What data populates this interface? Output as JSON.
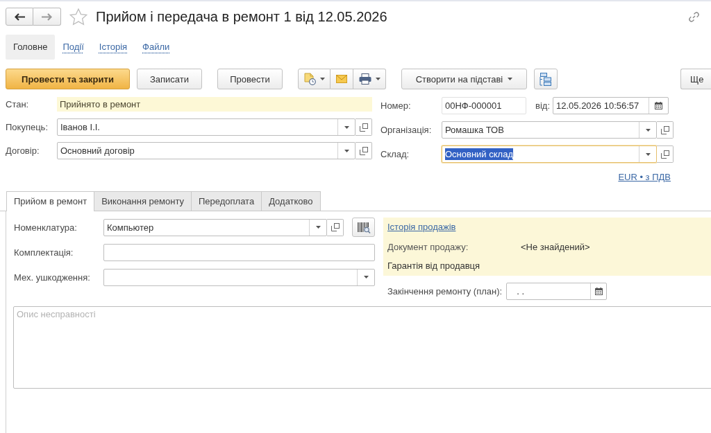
{
  "window": {
    "title": "Прийом і передача в ремонт 1 від 12.05.2026"
  },
  "sections": [
    {
      "label": "Головне",
      "selected": true
    },
    {
      "label": "Події",
      "selected": false
    },
    {
      "label": "Історія",
      "selected": false
    },
    {
      "label": "Файли",
      "selected": false
    }
  ],
  "toolbar": {
    "buttons": [
      {
        "label": "Провести та закрити",
        "kind": "primary"
      },
      {
        "label": "Записати",
        "kind": "plain"
      },
      {
        "label": "Провести",
        "kind": "plain"
      }
    ],
    "create_based_on": "Створити на підставі",
    "more": "Ще"
  },
  "header": {
    "status": {
      "label": "Стан:",
      "value": "Прийнято в ремонт"
    },
    "left_fields": [
      {
        "label": "Покупець:",
        "value": "Іванов І.І.",
        "focused": false
      },
      {
        "label": "Договір:",
        "value": "Основний договір",
        "focused": false
      }
    ],
    "number": {
      "label": "Номер:",
      "value": "00НФ-000001"
    },
    "date": {
      "label": "від:",
      "value": "12.05.2026 10:56:57"
    },
    "right_fields": [
      {
        "label": "Організація:",
        "value": "Ромашка ТОВ",
        "focused": false
      },
      {
        "label": "Склад:",
        "value": "Основний склад",
        "focused": true
      }
    ],
    "currency_link": "EUR • з ПДВ"
  },
  "tabs": [
    {
      "label": "Прийом в ремонт",
      "selected": true
    },
    {
      "label": "Виконання ремонту",
      "selected": false
    },
    {
      "label": "Передоплата",
      "selected": false
    },
    {
      "label": "Додатково",
      "selected": false
    }
  ],
  "repair_intake": {
    "fields": [
      {
        "kind": "catalog",
        "label": "Номенклатура:",
        "value": "Компьютер"
      },
      {
        "kind": "text",
        "label": "Комплектація:"
      },
      {
        "kind": "dropdown",
        "label": "Мех. ушкодження:"
      }
    ],
    "sales_info": {
      "link": "Історія продажів",
      "document_label": "Документ продажу:",
      "document_value": "<Не знайдений>",
      "warranty": "Гарантія від продавця"
    },
    "repair_end": {
      "label": "Закінчення ремонту (план):",
      "value": ". ."
    },
    "description": {
      "placeholder": "Опис несправності"
    }
  }
}
